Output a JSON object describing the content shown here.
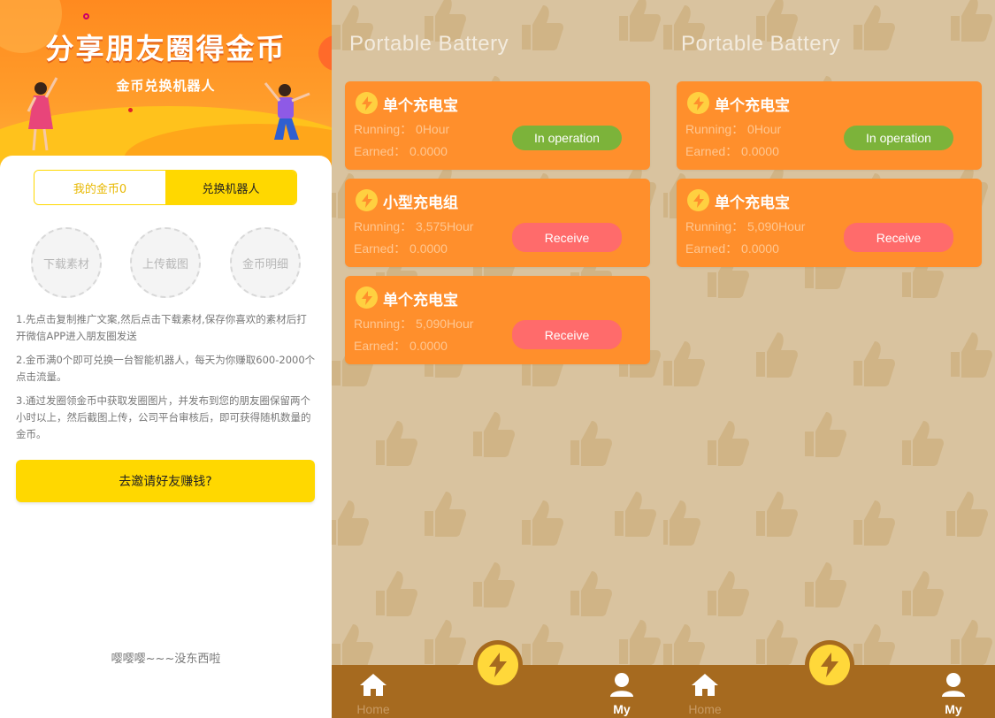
{
  "colors": {
    "banner_orange": "#ff8a1f",
    "gold": "#ffd800",
    "panel_bg": "#d9c39f",
    "card_orange": "#ff8f2c",
    "operation_green": "#7cb33a",
    "receive_red": "#ff6b6b",
    "tabbar_brown": "#a66a1f"
  },
  "left": {
    "banner_title": "分享朋友圈得金币",
    "banner_subtitle": "金币兑换机器人",
    "tabs": [
      {
        "label": "我的金币0",
        "active": false
      },
      {
        "label": "兑换机器人",
        "active": true
      }
    ],
    "actions": [
      {
        "label": "下载素材"
      },
      {
        "label": "上传截图"
      },
      {
        "label": "金币明细"
      }
    ],
    "rules": [
      "1.先点击复制推广文案,然后点击下载素材,保存你喜欢的素材后打开微信APP进入朋友圈发送",
      "2.金币满0个即可兑换一台智能机器人，每天为你赚取600-2000个点击流量。",
      "3.通过发圈领金币中获取发圈图片，并发布到您的朋友圈保留两个小时以上，然后截图上传，公司平台审核后，即可获得随机数量的金币。"
    ],
    "invite_button": "去邀请好友赚钱?",
    "empty_text": "嘤嘤嘤~~~没东西啦"
  },
  "panels": [
    {
      "title": "Portable Battery",
      "cards": [
        {
          "name": "单个充电宝",
          "running": "Running：  0Hour",
          "earned": "Earned：  0.0000",
          "button": "In operation",
          "status": "operation"
        },
        {
          "name": "小型充电组",
          "running": "Running：  3,575Hour",
          "earned": "Earned：  0.0000",
          "button": "Receive",
          "status": "receive"
        },
        {
          "name": "单个充电宝",
          "running": "Running：  5,090Hour",
          "earned": "Earned：  0.0000",
          "button": "Receive",
          "status": "receive"
        }
      ],
      "tabbar": {
        "home": "Home",
        "my": "My"
      }
    },
    {
      "title": "Portable Battery",
      "cards": [
        {
          "name": "单个充电宝",
          "running": "Running：  0Hour",
          "earned": "Earned：  0.0000",
          "button": "In operation",
          "status": "operation"
        },
        {
          "name": "单个充电宝",
          "running": "Running：  5,090Hour",
          "earned": "Earned：  0.0000",
          "button": "Receive",
          "status": "receive"
        }
      ],
      "tabbar": {
        "home": "Home",
        "my": "My"
      }
    }
  ],
  "icons": {
    "bolt": "lightning-bolt-icon",
    "home": "home-icon",
    "user": "user-icon",
    "background": "thumbs-up-icon"
  }
}
